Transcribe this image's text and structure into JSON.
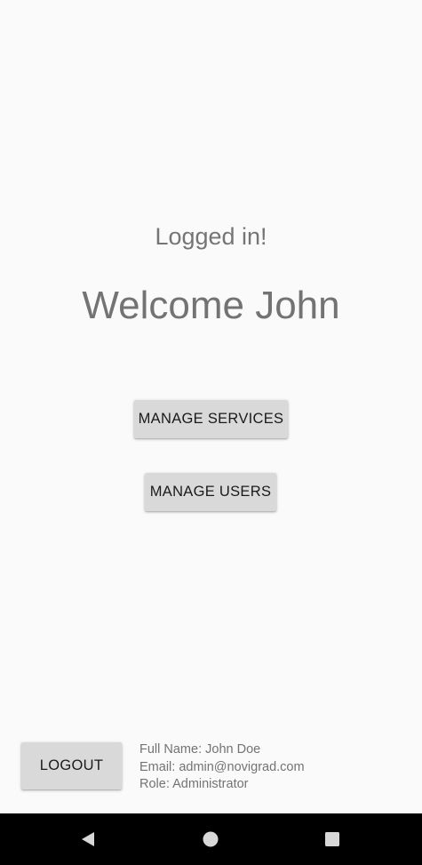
{
  "status": {
    "logged_in_text": "Logged in!",
    "welcome_text": "Welcome John"
  },
  "actions": {
    "manage_services_label": "MANAGE SERVICES",
    "manage_users_label": "MANAGE USERS",
    "logout_label": "LOGOUT"
  },
  "user": {
    "full_name_line": "Full Name: John Doe",
    "email_line": "Email: admin@novigrad.com",
    "role_line": "Role: Administrator"
  },
  "nav_bar": {
    "icons": [
      "back-icon",
      "home-icon",
      "recents-icon"
    ]
  },
  "colors": {
    "background": "#fafafa",
    "button_bg": "#d9d9d9",
    "text_gray": "#757575",
    "nav_bar": "#000000"
  }
}
